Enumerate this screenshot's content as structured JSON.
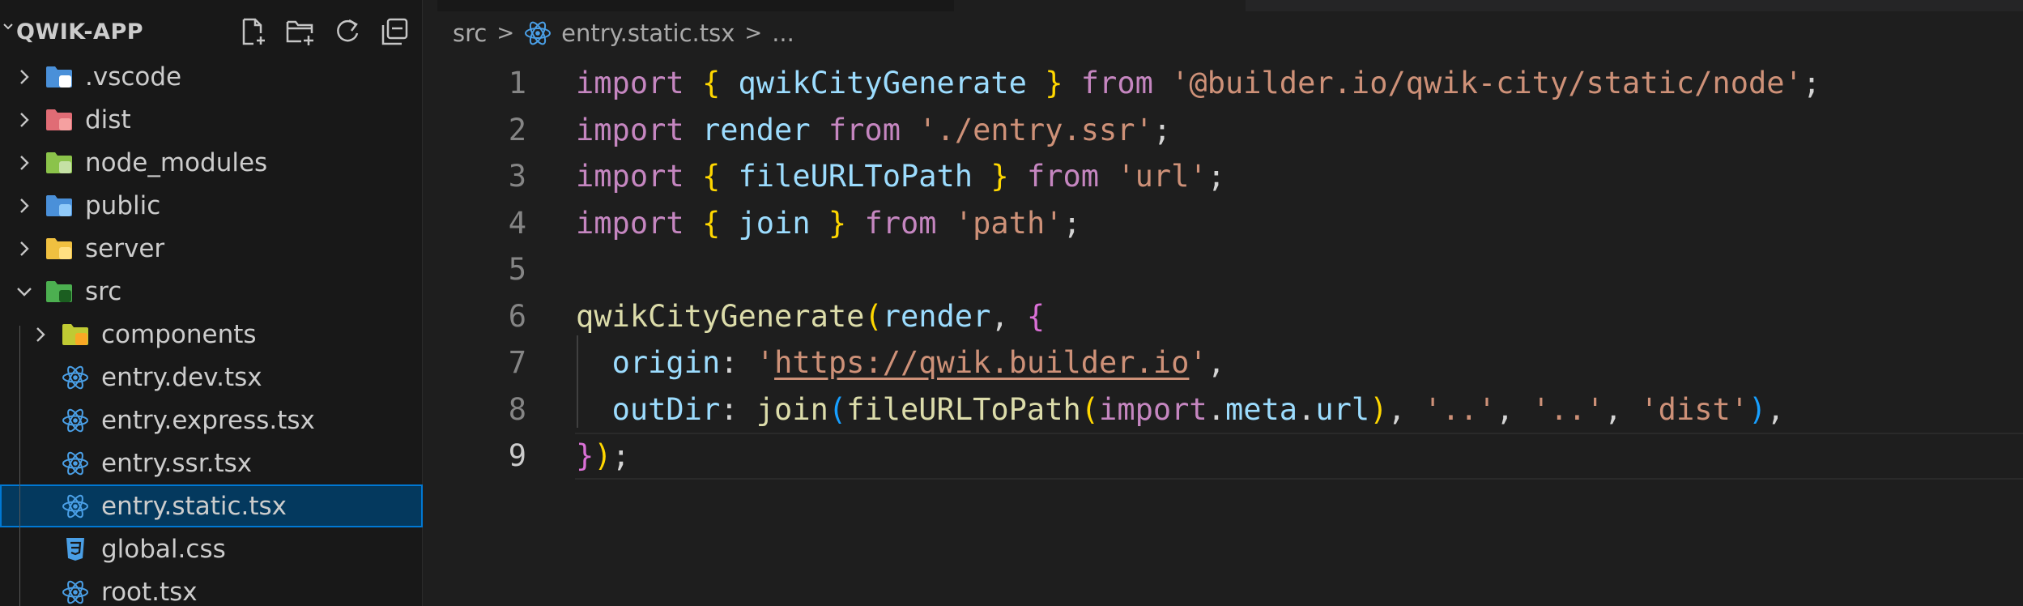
{
  "explorer": {
    "title": "QWIK-APP",
    "actions": [
      {
        "name": "new-file-icon"
      },
      {
        "name": "new-folder-icon"
      },
      {
        "name": "refresh-icon"
      },
      {
        "name": "collapse-all-icon"
      }
    ],
    "items": [
      {
        "label": ".vscode",
        "type": "folder",
        "expanded": false,
        "depth": 0,
        "icon": "vscode-folder-icon",
        "color": "#4a90d9"
      },
      {
        "label": "dist",
        "type": "folder",
        "expanded": false,
        "depth": 0,
        "icon": "dist-folder-icon",
        "color": "#e06c75"
      },
      {
        "label": "node_modules",
        "type": "folder",
        "expanded": false,
        "depth": 0,
        "icon": "node-modules-folder-icon",
        "color": "#8bc34a"
      },
      {
        "label": "public",
        "type": "folder",
        "expanded": false,
        "depth": 0,
        "icon": "public-folder-icon",
        "color": "#4a90d9"
      },
      {
        "label": "server",
        "type": "folder",
        "expanded": false,
        "depth": 0,
        "icon": "server-folder-icon",
        "color": "#f0c040"
      },
      {
        "label": "src",
        "type": "folder",
        "expanded": true,
        "depth": 0,
        "icon": "src-folder-icon",
        "color": "#4caf50"
      },
      {
        "label": "components",
        "type": "folder",
        "expanded": false,
        "depth": 1,
        "icon": "components-folder-icon",
        "color": "#c0ca33"
      },
      {
        "label": "entry.dev.tsx",
        "type": "file",
        "depth": 1,
        "icon": "react-icon",
        "color": "#4a9fe6"
      },
      {
        "label": "entry.express.tsx",
        "type": "file",
        "depth": 1,
        "icon": "react-icon",
        "color": "#4a9fe6"
      },
      {
        "label": "entry.ssr.tsx",
        "type": "file",
        "depth": 1,
        "icon": "react-icon",
        "color": "#4a9fe6"
      },
      {
        "label": "entry.static.tsx",
        "type": "file",
        "depth": 1,
        "icon": "react-icon",
        "color": "#4a9fe6",
        "selected": true
      },
      {
        "label": "global.css",
        "type": "file",
        "depth": 1,
        "icon": "css-icon",
        "color": "#4a9fe6"
      },
      {
        "label": "root.tsx",
        "type": "file",
        "depth": 1,
        "icon": "react-icon",
        "color": "#4a9fe6"
      }
    ]
  },
  "breadcrumb": {
    "folder": "src",
    "file": "entry.static.tsx",
    "more": "..."
  },
  "editor": {
    "current_line": 9,
    "lines": [
      {
        "n": "1",
        "tokens": [
          [
            "kw",
            "import"
          ],
          [
            "pun",
            " "
          ],
          [
            "br1",
            "{"
          ],
          [
            "pun",
            " "
          ],
          [
            "var",
            "qwikCityGenerate"
          ],
          [
            "pun",
            " "
          ],
          [
            "br1",
            "}"
          ],
          [
            "pun",
            " "
          ],
          [
            "kw",
            "from"
          ],
          [
            "pun",
            " "
          ],
          [
            "str",
            "'@builder.io/qwik-city/static/node'"
          ],
          [
            "pun",
            ";"
          ]
        ]
      },
      {
        "n": "2",
        "tokens": [
          [
            "kw",
            "import"
          ],
          [
            "pun",
            " "
          ],
          [
            "var",
            "render"
          ],
          [
            "pun",
            " "
          ],
          [
            "kw",
            "from"
          ],
          [
            "pun",
            " "
          ],
          [
            "str",
            "'./entry.ssr'"
          ],
          [
            "pun",
            ";"
          ]
        ]
      },
      {
        "n": "3",
        "tokens": [
          [
            "kw",
            "import"
          ],
          [
            "pun",
            " "
          ],
          [
            "br1",
            "{"
          ],
          [
            "pun",
            " "
          ],
          [
            "var",
            "fileURLToPath"
          ],
          [
            "pun",
            " "
          ],
          [
            "br1",
            "}"
          ],
          [
            "pun",
            " "
          ],
          [
            "kw",
            "from"
          ],
          [
            "pun",
            " "
          ],
          [
            "str",
            "'url'"
          ],
          [
            "pun",
            ";"
          ]
        ]
      },
      {
        "n": "4",
        "tokens": [
          [
            "kw",
            "import"
          ],
          [
            "pun",
            " "
          ],
          [
            "br1",
            "{"
          ],
          [
            "pun",
            " "
          ],
          [
            "var",
            "join"
          ],
          [
            "pun",
            " "
          ],
          [
            "br1",
            "}"
          ],
          [
            "pun",
            " "
          ],
          [
            "kw",
            "from"
          ],
          [
            "pun",
            " "
          ],
          [
            "str",
            "'path'"
          ],
          [
            "pun",
            ";"
          ]
        ]
      },
      {
        "n": "5",
        "tokens": []
      },
      {
        "n": "6",
        "tokens": [
          [
            "fn",
            "qwikCityGenerate"
          ],
          [
            "br1",
            "("
          ],
          [
            "var",
            "render"
          ],
          [
            "pun",
            ", "
          ],
          [
            "br2",
            "{"
          ]
        ]
      },
      {
        "n": "7",
        "tokens": [
          [
            "pun",
            "  "
          ],
          [
            "var",
            "origin"
          ],
          [
            "pun",
            ": "
          ],
          [
            "str",
            "'"
          ],
          [
            "link",
            "https://qwik.builder.io"
          ],
          [
            "str",
            "'"
          ],
          [
            "pun",
            ","
          ]
        ]
      },
      {
        "n": "8",
        "tokens": [
          [
            "pun",
            "  "
          ],
          [
            "var",
            "outDir"
          ],
          [
            "pun",
            ": "
          ],
          [
            "fn",
            "join"
          ],
          [
            "br3",
            "("
          ],
          [
            "fn",
            "fileURLToPath"
          ],
          [
            "br1",
            "("
          ],
          [
            "kw",
            "import"
          ],
          [
            "pun",
            "."
          ],
          [
            "var",
            "meta"
          ],
          [
            "pun",
            "."
          ],
          [
            "var",
            "url"
          ],
          [
            "br1",
            ")"
          ],
          [
            "pun",
            ", "
          ],
          [
            "str",
            "'..'"
          ],
          [
            "pun",
            ", "
          ],
          [
            "str",
            "'..'"
          ],
          [
            "pun",
            ", "
          ],
          [
            "str",
            "'dist'"
          ],
          [
            "br3",
            ")"
          ],
          [
            "pun",
            ","
          ]
        ]
      },
      {
        "n": "9",
        "tokens": [
          [
            "br2",
            "}"
          ],
          [
            "br1",
            ")"
          ],
          [
            "pun",
            ";"
          ]
        ]
      }
    ]
  },
  "colors": {
    "keyword": "#c586c0",
    "variable": "#9cdcfe",
    "function": "#dcdcaa",
    "string": "#ce9178",
    "bracket_gold": "#ffd700",
    "bracket_orchid": "#da70d6",
    "bracket_blue": "#179fff",
    "selection": "#04395e",
    "focus_border": "#0078d4"
  }
}
